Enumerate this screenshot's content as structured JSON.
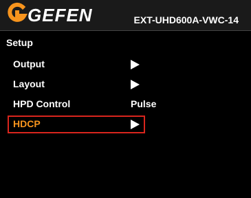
{
  "header": {
    "brand": "GEFEN",
    "model": "EXT-UHD600A-VWC-14"
  },
  "menu": {
    "title": "Setup",
    "items": [
      {
        "label": "Output",
        "value": "",
        "arrow": true
      },
      {
        "label": "Layout",
        "value": "",
        "arrow": true
      },
      {
        "label": "HPD Control",
        "value": "Pulse",
        "arrow": false
      },
      {
        "label": "HDCP",
        "value": "",
        "arrow": true,
        "selected": true
      }
    ]
  },
  "colors": {
    "selected_text": "#f7941d",
    "selection_border": "#d9251d",
    "logo_orange": "#f7941d"
  }
}
